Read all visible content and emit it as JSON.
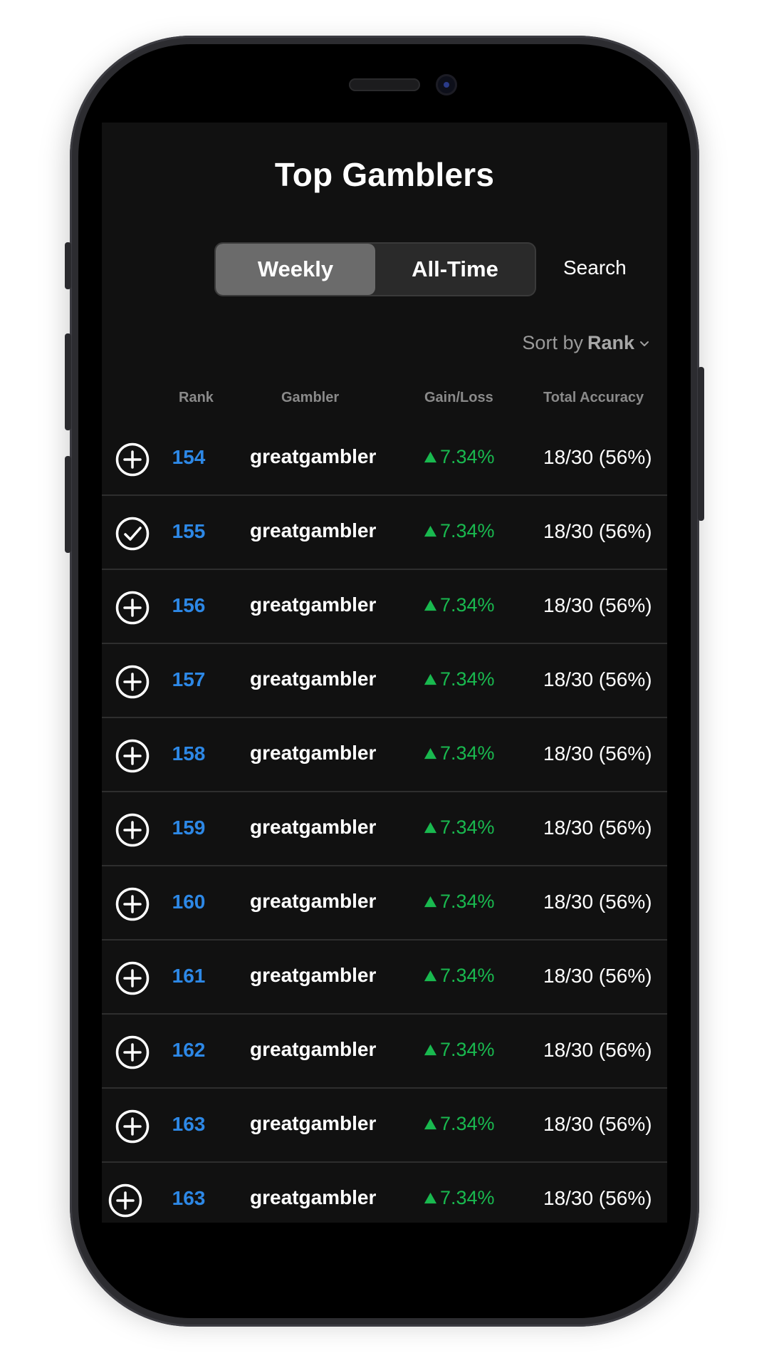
{
  "header": {
    "title": "Top Gamblers"
  },
  "segments": [
    {
      "label": "Weekly",
      "active": true
    },
    {
      "label": "All-Time",
      "active": false
    }
  ],
  "search": {
    "label": "Search"
  },
  "sort": {
    "prefix": "Sort by",
    "value": "Rank"
  },
  "columns": {
    "rank": "Rank",
    "gambler": "Gambler",
    "gain_loss": "Gain/Loss",
    "total_accuracy": "Total Accuracy"
  },
  "colors": {
    "background": "#111111",
    "rank_blue": "#2d88e6",
    "gain_green": "#19b94f",
    "segment_active": "#6b6b6b"
  },
  "rows": [
    {
      "icon": "plus-circle-icon",
      "rank": "154",
      "gambler": "greatgambler",
      "gain": "7.34%",
      "accuracy": "18/30 (56%)"
    },
    {
      "icon": "check-circle-icon",
      "rank": "155",
      "gambler": "greatgambler",
      "gain": "7.34%",
      "accuracy": "18/30 (56%)"
    },
    {
      "icon": "plus-circle-icon",
      "rank": "156",
      "gambler": "greatgambler",
      "gain": "7.34%",
      "accuracy": "18/30 (56%)"
    },
    {
      "icon": "plus-circle-icon",
      "rank": "157",
      "gambler": "greatgambler",
      "gain": "7.34%",
      "accuracy": "18/30 (56%)"
    },
    {
      "icon": "plus-circle-icon",
      "rank": "158",
      "gambler": "greatgambler",
      "gain": "7.34%",
      "accuracy": "18/30 (56%)"
    },
    {
      "icon": "plus-circle-icon",
      "rank": "159",
      "gambler": "greatgambler",
      "gain": "7.34%",
      "accuracy": "18/30 (56%)"
    },
    {
      "icon": "plus-circle-icon",
      "rank": "160",
      "gambler": "greatgambler",
      "gain": "7.34%",
      "accuracy": "18/30 (56%)"
    },
    {
      "icon": "plus-circle-icon",
      "rank": "161",
      "gambler": "greatgambler",
      "gain": "7.34%",
      "accuracy": "18/30 (56%)"
    },
    {
      "icon": "plus-circle-icon",
      "rank": "162",
      "gambler": "greatgambler",
      "gain": "7.34%",
      "accuracy": "18/30 (56%)"
    },
    {
      "icon": "plus-circle-icon",
      "rank": "163",
      "gambler": "greatgambler",
      "gain": "7.34%",
      "accuracy": "18/30 (56%)"
    },
    {
      "icon": "plus-circle-icon",
      "rank": "163",
      "gambler": "greatgambler",
      "gain": "7.34%",
      "accuracy": "18/30 (56%)"
    }
  ]
}
